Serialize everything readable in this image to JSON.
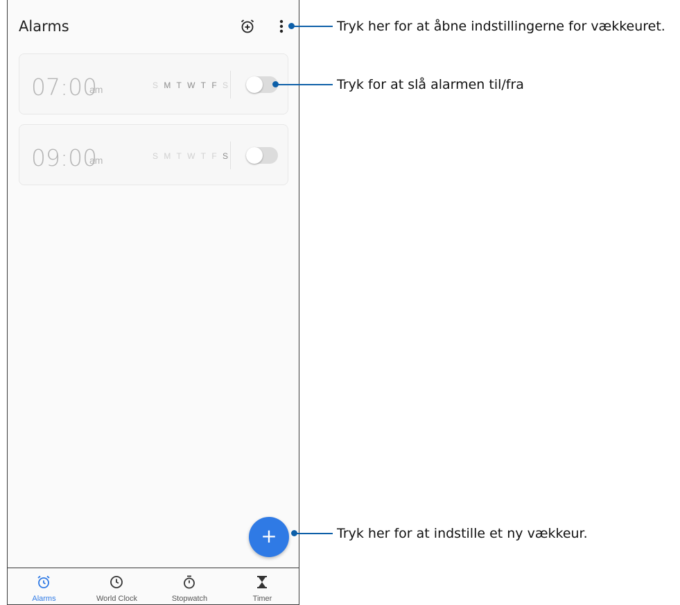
{
  "appbar": {
    "title": "Alarms",
    "add_icon": "alarm-add-icon",
    "menu_icon": "more-vertical-icon"
  },
  "alarms": [
    {
      "time": "07:00",
      "ampm": "am",
      "days": [
        "S",
        "M",
        "T",
        "W",
        "T",
        "F",
        "S"
      ],
      "days_active": [
        false,
        true,
        true,
        true,
        true,
        true,
        false
      ],
      "enabled": false
    },
    {
      "time": "09:00",
      "ampm": "am",
      "days": [
        "S",
        "M",
        "T",
        "W",
        "T",
        "F",
        "S"
      ],
      "days_active": [
        false,
        false,
        false,
        false,
        false,
        false,
        true
      ],
      "enabled": false
    }
  ],
  "fab": {
    "label": "+"
  },
  "nav": [
    {
      "label": "Alarms",
      "icon": "alarm-clock-icon",
      "active": true
    },
    {
      "label": "World Clock",
      "icon": "clock-icon",
      "active": false
    },
    {
      "label": "Stopwatch",
      "icon": "stopwatch-icon",
      "active": false
    },
    {
      "label": "Timer",
      "icon": "hourglass-icon",
      "active": false
    }
  ],
  "callouts": {
    "settings": "Tryk her for at åbne indstillingerne for vækkeuret.",
    "toggle": "Tryk for at slå alarmen til/fra",
    "new_alarm": "Tryk her for at indstille et ny vækkeur."
  },
  "colors": {
    "accent": "#2f7ae5",
    "callout": "#0d5fa8"
  }
}
